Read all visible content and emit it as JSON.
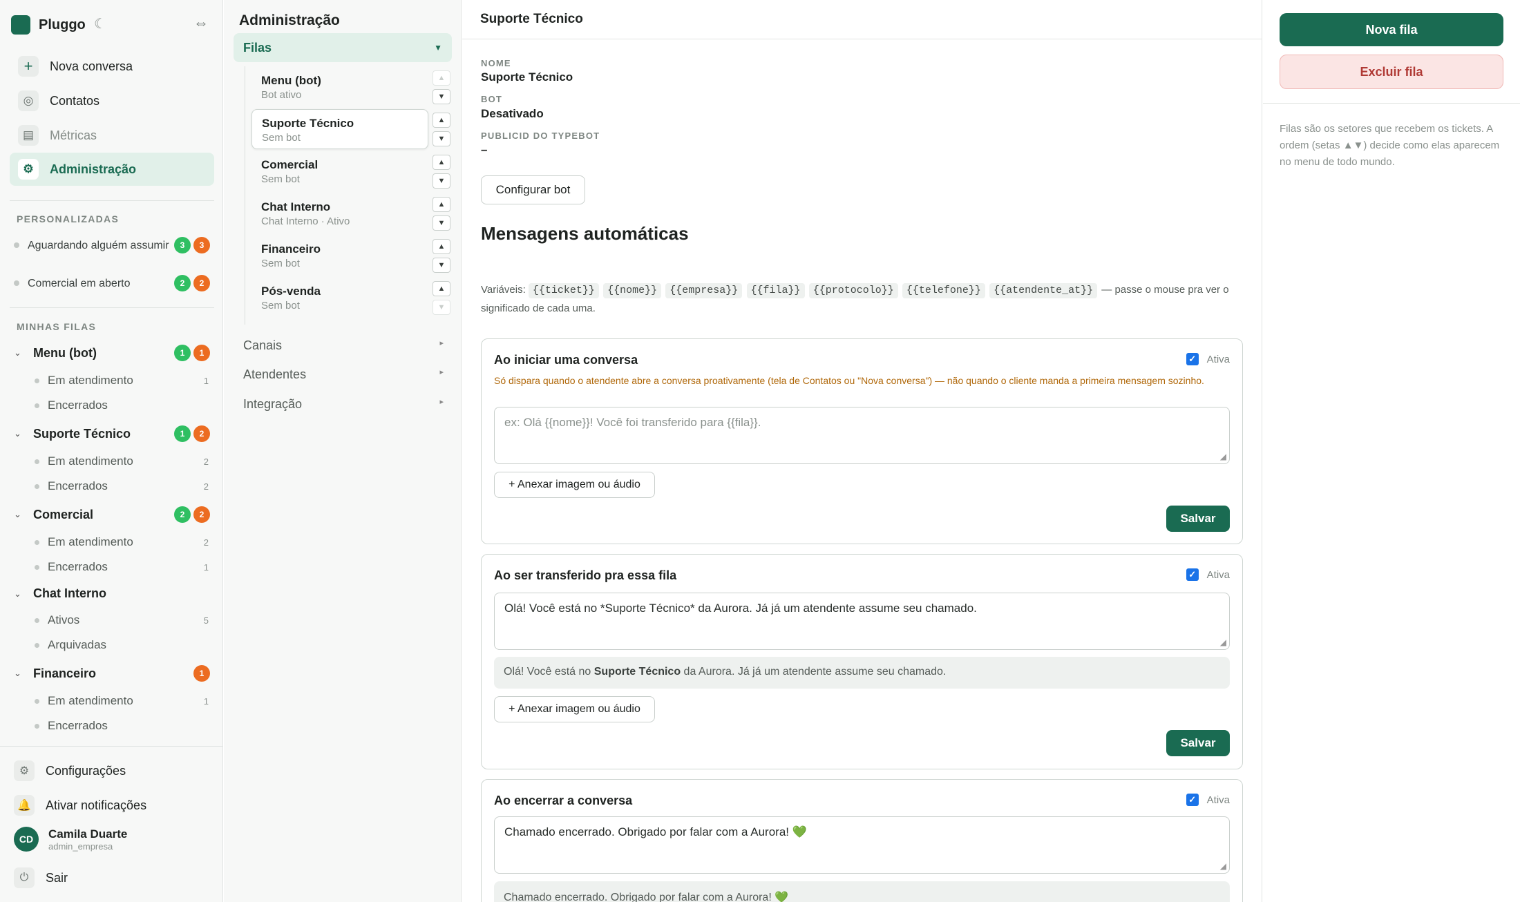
{
  "sidebar": {
    "app_name": "Pluggo",
    "nav": [
      {
        "label": "Nova conversa",
        "icon": "plus-icon"
      },
      {
        "label": "Contatos",
        "icon": "contacts-icon"
      },
      {
        "label": "Métricas",
        "icon": "chart-icon"
      },
      {
        "label": "Administração",
        "icon": "gear-icon"
      }
    ],
    "section_custom": "PERSONALIZADAS",
    "custom_views": [
      {
        "label": "Aguardando alguém assumir",
        "green": "3",
        "orange": "3"
      },
      {
        "label": "Comercial em aberto",
        "green": "2",
        "orange": "2"
      }
    ],
    "section_queues": "MINHAS FILAS",
    "queues": [
      {
        "label": "Menu (bot)",
        "green": "1",
        "orange": "1",
        "subs": [
          {
            "label": "Em atendimento",
            "count": "1"
          },
          {
            "label": "Encerrados",
            "count": ""
          }
        ]
      },
      {
        "label": "Suporte Técnico",
        "green": "1",
        "orange": "2",
        "subs": [
          {
            "label": "Em atendimento",
            "count": "2"
          },
          {
            "label": "Encerrados",
            "count": "2"
          }
        ]
      },
      {
        "label": "Comercial",
        "green": "2",
        "orange": "2",
        "subs": [
          {
            "label": "Em atendimento",
            "count": "2"
          },
          {
            "label": "Encerrados",
            "count": "1"
          }
        ]
      },
      {
        "label": "Chat Interno",
        "subs": [
          {
            "label": "Ativos",
            "count": "5"
          },
          {
            "label": "Arquivadas",
            "count": ""
          }
        ]
      },
      {
        "label": "Financeiro",
        "orange": "1",
        "subs": [
          {
            "label": "Em atendimento",
            "count": "1"
          },
          {
            "label": "Encerrados",
            "count": ""
          }
        ]
      }
    ],
    "footer": {
      "settings": "Configurações",
      "notifications": "Ativar notificações",
      "user_initials": "CD",
      "user_name": "Camila Duarte",
      "user_role": "admin_empresa",
      "logout": "Sair"
    }
  },
  "admin": {
    "title": "Administração",
    "filas_label": "Filas",
    "queues": [
      {
        "title": "Menu (bot)",
        "subtitle": "Bot ativo"
      },
      {
        "title": "Suporte Técnico",
        "subtitle": "Sem bot"
      },
      {
        "title": "Comercial",
        "subtitle": "Sem bot"
      },
      {
        "title": "Chat Interno",
        "subtitle": "Chat Interno · Ativo"
      },
      {
        "title": "Financeiro",
        "subtitle": "Sem bot"
      },
      {
        "title": "Pós-venda",
        "subtitle": "Sem bot"
      }
    ],
    "sections": [
      "Canais",
      "Atendentes",
      "Integração"
    ]
  },
  "main": {
    "header": "Suporte Técnico",
    "fields": [
      {
        "label": "NOME",
        "value": "Suporte Técnico"
      },
      {
        "label": "BOT",
        "value": "Desativado"
      },
      {
        "label": "PUBLICID DO TYPEBOT",
        "value": "–"
      }
    ],
    "configure_bot": "Configurar bot",
    "auto_title": "Mensagens automáticas",
    "vars_prefix": "Variáveis:",
    "vars": [
      "{{ticket}}",
      "{{nome}}",
      "{{empresa}}",
      "{{fila}}",
      "{{protocolo}}",
      "{{telefone}}",
      "{{atendente_at}}"
    ],
    "vars_suffix": "— passe o mouse pra ver o significado de cada uma.",
    "active_label": "Ativa",
    "attach_label": "+ Anexar imagem ou áudio",
    "save_label": "Salvar",
    "cards": [
      {
        "title": "Ao iniciar uma conversa",
        "warning": "Só dispara quando o atendente abre a conversa proativamente (tela de Contatos ou \"Nova conversa\") — não quando o cliente manda a primeira mensagem sozinho.",
        "placeholder": "ex: Olá {{nome}}! Você foi transferido para {{fila}}."
      },
      {
        "title": "Ao ser transferido pra essa fila",
        "value": "Olá! Você está no *Suporte Técnico* da Aurora. Já já um atendente assume seu chamado.",
        "preview_before": "Olá! Você está no ",
        "preview_bold": "Suporte Técnico",
        "preview_after": " da Aurora. Já já um atendente assume seu chamado."
      },
      {
        "title": "Ao encerrar a conversa",
        "value": "Chamado encerrado. Obrigado por falar com a Aurora! 💚",
        "preview": "Chamado encerrado. Obrigado por falar com a Aurora! 💚"
      }
    ]
  },
  "right": {
    "new_queue": "Nova fila",
    "delete_queue": "Excluir fila",
    "help": "Filas são os setores que recebem os tickets. A ordem (setas ▲▼) decide como elas aparecem no menu de todo mundo."
  },
  "colors": {
    "brand": "#1a6b52",
    "badge_green": "#2fbf62",
    "badge_orange": "#ec6c21",
    "danger": "#b03a35"
  }
}
